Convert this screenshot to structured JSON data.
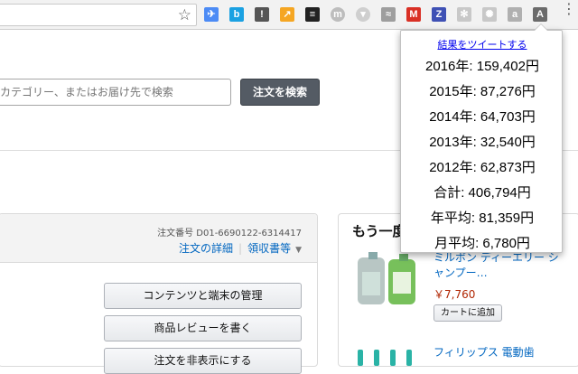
{
  "browser": {
    "extensions": [
      {
        "icon": "pushpin-extension-icon",
        "color": "#4c8bf5",
        "glyph": "✈"
      },
      {
        "icon": "b-extension-icon",
        "color": "#1ba1e2",
        "glyph": "b"
      },
      {
        "icon": "circle-extension-icon",
        "color": "#555555",
        "glyph": "!"
      },
      {
        "icon": "chart-extension-icon",
        "color": "#f5a623",
        "glyph": "↗"
      },
      {
        "icon": "layers-extension-icon",
        "color": "#222222",
        "glyph": "≡"
      },
      {
        "icon": "m-extension-icon",
        "color": "#bdbdbd",
        "glyph": "m"
      },
      {
        "icon": "down-arrow-extension-icon",
        "color": "#cfcfcf",
        "glyph": "▾"
      },
      {
        "icon": "feed-extension-icon",
        "color": "#9e9e9e",
        "glyph": "≈"
      },
      {
        "icon": "gmail-extension-icon",
        "color": "#d93025",
        "glyph": "M"
      },
      {
        "icon": "z-extension-icon",
        "color": "#3f51b5",
        "glyph": "Z"
      },
      {
        "icon": "gear-extension-icon",
        "color": "#c8c8c8",
        "glyph": "✻"
      },
      {
        "icon": "atom-extension-icon",
        "color": "#c8c8c8",
        "glyph": "✺"
      },
      {
        "icon": "a-extension-icon",
        "color": "#b0b0b0",
        "glyph": "a"
      },
      {
        "icon": "active-a-extension-icon",
        "color": "#6b6b6b",
        "glyph": "A"
      }
    ],
    "star_glyph": "☆",
    "menu_glyph": "⋮"
  },
  "search": {
    "placeholder": "カテゴリー、またはお届け先で検索",
    "button_label": "注文を検索"
  },
  "order": {
    "number": "注文番号 D01-6690122-6314417",
    "detail_link": "注文の詳細",
    "receipt_link": "領収書等",
    "buttons": [
      "コンテンツと端末の管理",
      "商品レビューを書く",
      "注文を非表示にする"
    ]
  },
  "recommendations": {
    "title": "もう一度買う",
    "product1": {
      "title": "ミルボン ディーエリー シャンプー…",
      "price": "￥7,760",
      "cart_label": "カートに追加"
    },
    "product2": {
      "title": "フィリップス 電動歯"
    }
  },
  "popup": {
    "tweet_link": "結果をツイートする",
    "lines": [
      "2016年: 159,402円",
      "2015年: 87,276円",
      "2014年: 64,703円",
      "2013年: 32,540円",
      "2012年: 62,873円",
      "合計: 406,794円",
      "年平均: 81,359円",
      "月平均: 6,780円"
    ]
  }
}
